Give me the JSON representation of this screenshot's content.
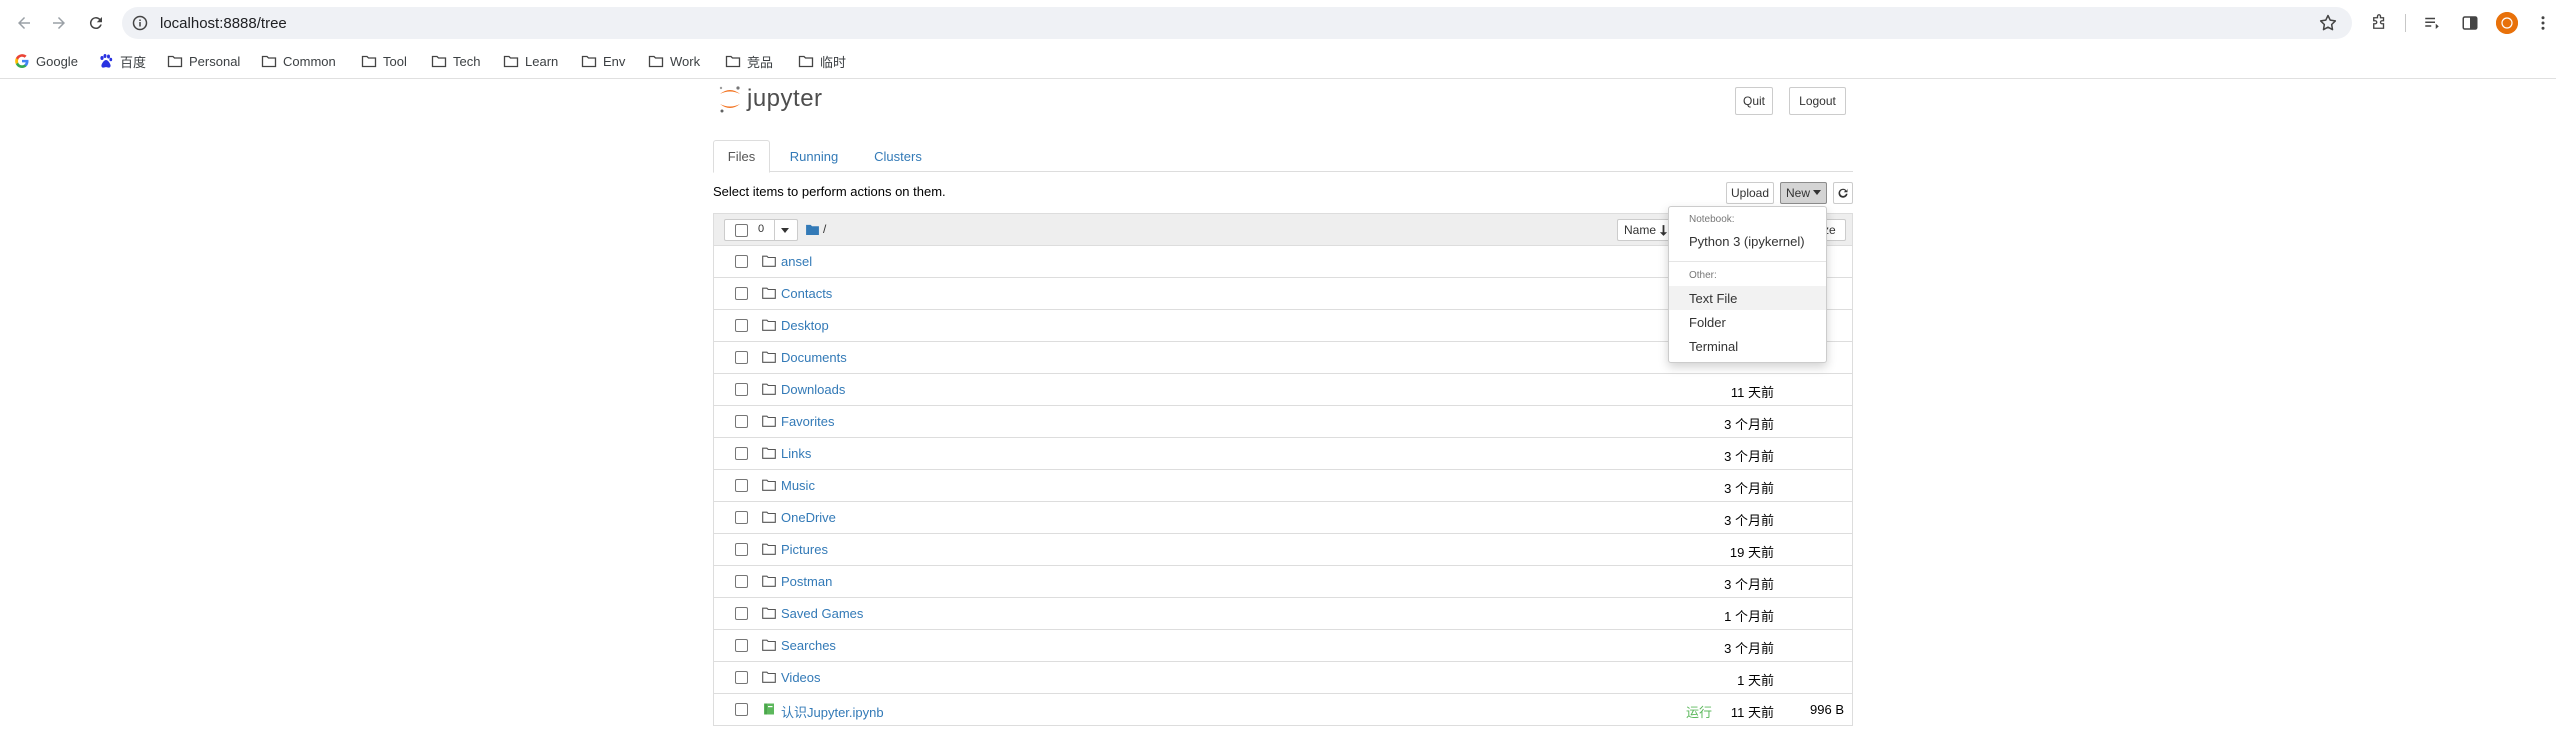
{
  "browser": {
    "url": "localhost:8888/tree",
    "bookmarks": [
      {
        "label": "Google",
        "icon": "google-icon"
      },
      {
        "label": "百度",
        "icon": "baidu-icon"
      },
      {
        "label": "Personal",
        "icon": "folder-icon"
      },
      {
        "label": "Common",
        "icon": "folder-icon"
      },
      {
        "label": "Tool",
        "icon": "folder-icon"
      },
      {
        "label": "Tech",
        "icon": "folder-icon"
      },
      {
        "label": "Learn",
        "icon": "folder-icon"
      },
      {
        "label": "Env",
        "icon": "folder-icon"
      },
      {
        "label": "Work",
        "icon": "folder-icon"
      },
      {
        "label": "竞品",
        "icon": "folder-icon"
      },
      {
        "label": "临时",
        "icon": "folder-icon"
      }
    ]
  },
  "header": {
    "logo_text": "jupyter",
    "quit_label": "Quit",
    "logout_label": "Logout"
  },
  "tabs": [
    {
      "label": "Files",
      "active": true
    },
    {
      "label": "Running",
      "active": false
    },
    {
      "label": "Clusters",
      "active": false
    }
  ],
  "toolbar": {
    "hint": "Select items to perform actions on them.",
    "upload_label": "Upload",
    "new_label": "New"
  },
  "list_header": {
    "selected_count": "0",
    "breadcrumb": "/",
    "sort_label": "Name",
    "size_label": "ze"
  },
  "files": [
    {
      "name": "ansel",
      "type": "folder",
      "modified": "",
      "size": "",
      "running": ""
    },
    {
      "name": "Contacts",
      "type": "folder",
      "modified": "",
      "size": "",
      "running": ""
    },
    {
      "name": "Desktop",
      "type": "folder",
      "modified": "",
      "size": "",
      "running": ""
    },
    {
      "name": "Documents",
      "type": "folder",
      "modified": "",
      "size": "",
      "running": ""
    },
    {
      "name": "Downloads",
      "type": "folder",
      "modified": "11 天前",
      "size": "",
      "running": ""
    },
    {
      "name": "Favorites",
      "type": "folder",
      "modified": "3 个月前",
      "size": "",
      "running": ""
    },
    {
      "name": "Links",
      "type": "folder",
      "modified": "3 个月前",
      "size": "",
      "running": ""
    },
    {
      "name": "Music",
      "type": "folder",
      "modified": "3 个月前",
      "size": "",
      "running": ""
    },
    {
      "name": "OneDrive",
      "type": "folder",
      "modified": "3 个月前",
      "size": "",
      "running": ""
    },
    {
      "name": "Pictures",
      "type": "folder",
      "modified": "19 天前",
      "size": "",
      "running": ""
    },
    {
      "name": "Postman",
      "type": "folder",
      "modified": "3 个月前",
      "size": "",
      "running": ""
    },
    {
      "name": "Saved Games",
      "type": "folder",
      "modified": "1 个月前",
      "size": "",
      "running": ""
    },
    {
      "name": "Searches",
      "type": "folder",
      "modified": "3 个月前",
      "size": "",
      "running": ""
    },
    {
      "name": "Videos",
      "type": "folder",
      "modified": "1 天前",
      "size": "",
      "running": ""
    },
    {
      "name": "认识Jupyter.ipynb",
      "type": "notebook",
      "modified": "11 天前",
      "size": "996 B",
      "running": "运行"
    }
  ],
  "new_menu": {
    "notebook_header": "Notebook:",
    "kernel_item": "Python 3 (ipykernel)",
    "other_header": "Other:",
    "text_file_item": "Text File",
    "folder_item": "Folder",
    "terminal_item": "Terminal"
  },
  "colors": {
    "link": "#337ab7",
    "running": "#5cb85c",
    "jupyter_orange": "#f37726"
  }
}
